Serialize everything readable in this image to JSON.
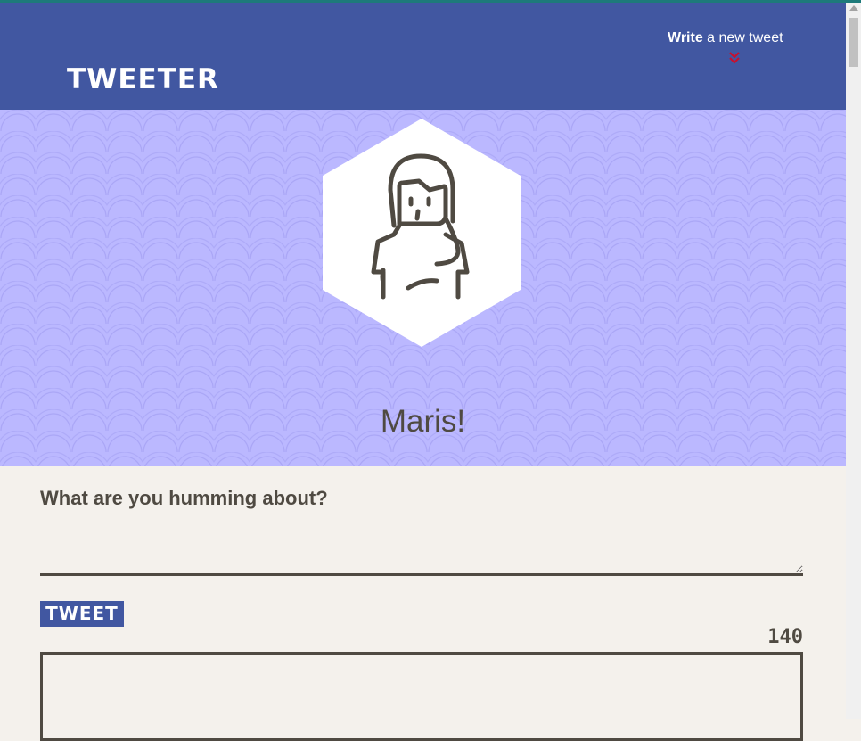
{
  "nav": {
    "brand": "Tweeter",
    "compose_strong": "Write",
    "compose_rest": " a new tweet",
    "chevron_icon": "double-chevron-down-icon"
  },
  "header": {
    "avatar_icon": "woman-avatar-icon",
    "user_name": "Maris!"
  },
  "compose": {
    "label": "What are you humming about?",
    "input_value": "",
    "button_label": "Tweet",
    "counter": "140"
  },
  "colors": {
    "nav_bg": "#4157a1",
    "header_bg": "#bbb8ff",
    "page_bg": "#f4f1ec",
    "text": "#4f4a42",
    "chevron": "#c8102e"
  }
}
